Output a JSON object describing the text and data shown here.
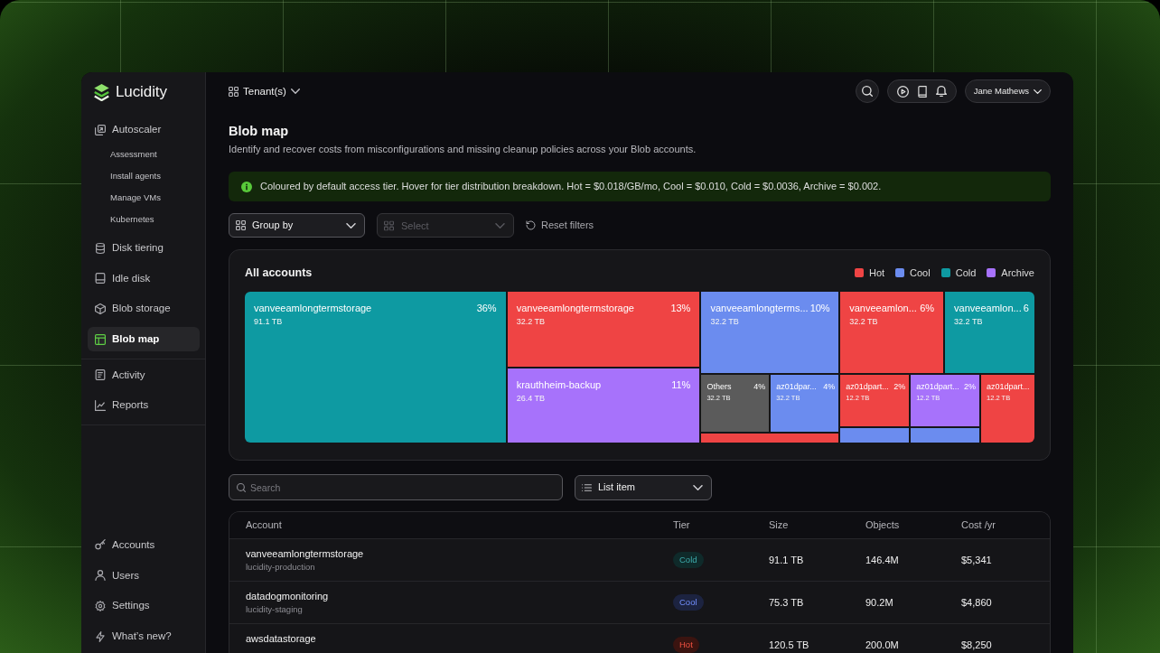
{
  "sidebar": {
    "brand": "Lucidity",
    "groups": [
      {
        "items": [
          {
            "label": "Autoscaler",
            "selected": false,
            "children": [
              {
                "label": "Assessment",
                "selected": false
              },
              {
                "label": "Install agents",
                "selected": false
              },
              {
                "label": "Manage VMs",
                "selected": false
              },
              {
                "label": "Kubernetes",
                "selected": false
              }
            ]
          },
          {
            "label": "Disk tiering",
            "selected": false
          },
          {
            "label": "Idle disk",
            "selected": false
          },
          {
            "label": "Blob storage",
            "selected": false
          },
          {
            "label": "Blob map",
            "selected": true
          }
        ]
      },
      {
        "items": [
          {
            "label": "Activity",
            "selected": false
          },
          {
            "label": "Reports",
            "selected": false
          }
        ]
      },
      {
        "items": [
          {
            "label": "Accounts",
            "selected": false
          },
          {
            "label": "Users",
            "selected": false
          },
          {
            "label": "Settings",
            "selected": false
          },
          {
            "label": "What’s new?",
            "selected": false
          }
        ]
      }
    ]
  },
  "top_bar": {
    "tenant_selector": "Tenant(s)",
    "user_menu": "Jane Mathews"
  },
  "page": {
    "title": "Blob map",
    "description": "Identify and recover costs from misconfigurations and missing cleanup policies across your Blob accounts."
  },
  "info_banner": {
    "text": "Coloured by default access tier. Hover for tier distribution breakdown. Hot = $0.018/GB/mo, Cool = $0.010, Cold = $0.0036, Archive = $0.002."
  },
  "filters": {
    "group_by": "Group by",
    "select": {
      "placeholder": "Select",
      "disabled": true
    },
    "reset": "Reset filters"
  },
  "treemap": {
    "title": "All accounts",
    "legend": [
      {
        "label": "Hot",
        "color": "#ef4444"
      },
      {
        "label": "Cool",
        "color": "#6b8cef"
      },
      {
        "label": "Cold",
        "color": "#0e9aa2"
      },
      {
        "label": "Archive",
        "color": "#a772fb"
      }
    ],
    "tiles": [
      {
        "label": "vanveeamlongtermstorage",
        "share": "36%",
        "size": "91.1 TB",
        "color": "#0e9aa2"
      },
      {
        "label": "vanveeamlongtermstorage",
        "share": "13%",
        "size": "32.2 TB",
        "color": "#ef4444"
      },
      {
        "label": "vanveeamlongterms...",
        "share": "10%",
        "size": "32.2 TB",
        "color": "#6b8cef"
      },
      {
        "label": "vanveeamlon...",
        "share": "6%",
        "size": "32.2 TB",
        "color": "#ef4444"
      },
      {
        "label": "vanveeamlon...",
        "share": "6",
        "size": "32.2 TB",
        "color": "#0e9aa2"
      },
      {
        "label": "krauthheim-backup",
        "share": "11%",
        "size": "26.4 TB",
        "color": "#a772fb"
      },
      {
        "label": "Others",
        "share": "4%",
        "size": "32.2 TB",
        "color": "#5b5b5b"
      },
      {
        "label": "az01dpar...",
        "share": "4%",
        "size": "32.2 TB",
        "color": "#6b8cef"
      },
      {
        "label": "az01dpart...",
        "share": "2%",
        "size": "12.2 TB",
        "color": "#ef4444"
      },
      {
        "label": "az01dpart...",
        "share": "2%",
        "size": "12.2 TB",
        "color": "#a772fb"
      },
      {
        "label": "az01dpart...",
        "size": "12.2 TB",
        "color": "#ef4444"
      },
      {
        "color": "#ef4444"
      },
      {
        "color": "#6b8cef"
      },
      {
        "color": "#6b8cef"
      }
    ]
  },
  "table_tools": {
    "search": {
      "placeholder": "Search"
    },
    "view_select": "List item"
  },
  "table": {
    "columns": [
      "Account",
      "Tier",
      "Size",
      "Objects",
      "Cost /yr"
    ],
    "rows": [
      {
        "account": "vanveeamlongtermstorage",
        "subtitle": "lucidity-production",
        "tier": "Cold",
        "color": "#0f2a2a",
        "size": "91.1 TB",
        "objects": "146.4M",
        "cost": "$5,341"
      },
      {
        "account": "datadogmonitoring",
        "subtitle": "lucidity-staging",
        "tier": "Cool",
        "color": "#1c2340",
        "size": "75.3 TB",
        "objects": "90.2M",
        "cost": "$4,860"
      },
      {
        "account": "awsdatastorage",
        "tier": "Hot",
        "color": "#3b1410",
        "size": "120.5 TB",
        "objects": "200.0M",
        "cost": "$8,250"
      }
    ]
  }
}
